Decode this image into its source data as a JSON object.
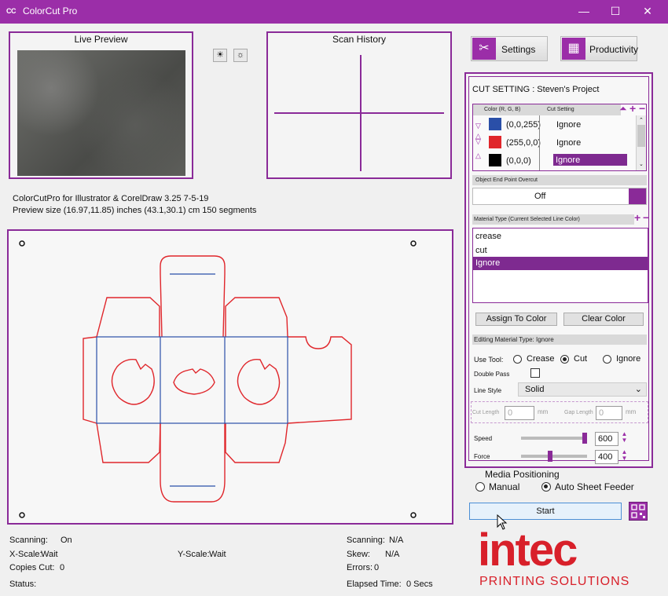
{
  "window": {
    "logo": "CC",
    "title": "ColorCut Pro",
    "minimize": "—",
    "maximize": "☐",
    "close": "✕"
  },
  "live_preview": {
    "title": "Live Preview"
  },
  "scan_history": {
    "title": "Scan History"
  },
  "preview_buttons": [
    "☀",
    "☼"
  ],
  "info": {
    "line1": "ColorCutPro for Illustrator & CorelDraw 3.25 7-5-19",
    "line2": "Preview size (16.97,11.85) inches  (43.1,30.1) cm   150 segments"
  },
  "toolbar": {
    "settings_label": "Settings",
    "settings_icon": "✂",
    "productivity_label": "Productivity",
    "productivity_icon": "▦"
  },
  "cut_setting": {
    "title": "CUT SETTING : Steven's Project",
    "col_color": "Color (R, G, B)",
    "col_cut": "Cut Setting",
    "rows": [
      {
        "rgb": "(0,0,255)",
        "setting": "Ignore",
        "color": "#2a4fa8"
      },
      {
        "rgb": "(255,0,0)",
        "setting": "Ignore",
        "color": "#e0262b"
      },
      {
        "rgb": "(0,0,0)",
        "setting": "Ignore",
        "color": "#000000"
      }
    ],
    "overcut_label": "Object End Point Overcut",
    "overcut_value": "Off",
    "material_type_label": "Material Type (Current Selected Line Color)",
    "materials": [
      "crease",
      "cut",
      "Ignore"
    ],
    "assign_button": "Assign To Color",
    "clear_button": "Clear Color",
    "editing_label": "Editing Material Type: Ignore",
    "use_tool_label": "Use Tool:",
    "tools": [
      "Crease",
      "Cut",
      "Ignore"
    ],
    "double_pass_label": "Double Pass",
    "line_style_label": "Line Style",
    "line_style_value": "Solid",
    "cut_length_label": "Cut Length",
    "cut_length_value": "0",
    "gap_length_label": "Gap Length",
    "gap_length_value": "0",
    "mm": "mm",
    "speed_label": "Speed",
    "speed_value": "600",
    "force_label": "Force",
    "force_value": "400"
  },
  "media": {
    "title": "Media Positioning",
    "manual": "Manual",
    "auto": "Auto Sheet Feeder"
  },
  "start_button": "Start",
  "status": {
    "scanning_left_label": "Scanning:",
    "scanning_left_value": "On",
    "xscale_label": "X-Scale:",
    "xscale_value": "Wait",
    "yscale_label": "Y-Scale:",
    "yscale_value": "Wait",
    "copies_label": "Copies Cut:",
    "copies_value": "0",
    "status_label": "Status:",
    "scanning_right_label": "Scanning:",
    "scanning_right_value": "N/A",
    "skew_label": "Skew:",
    "skew_value": "N/A",
    "errors_label": "Errors:",
    "errors_value": "0",
    "elapsed_label": "Elapsed Time:",
    "elapsed_value": "0 Secs"
  },
  "brand": {
    "name": "intec",
    "tagline": "PRINTING SOLUTIONS",
    "color": "#d8202a"
  }
}
